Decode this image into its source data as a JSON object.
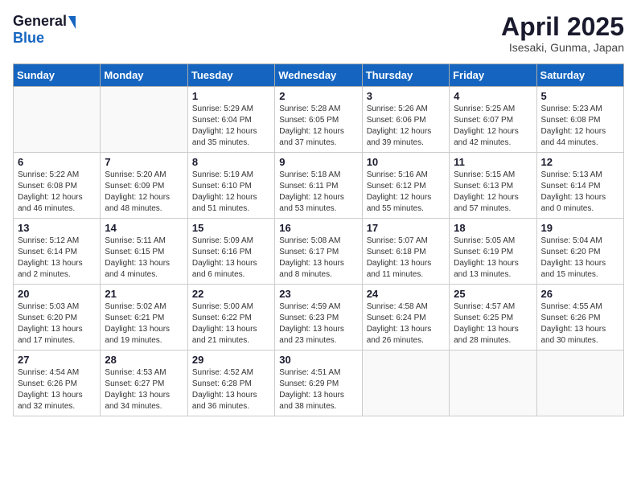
{
  "header": {
    "logo_general": "General",
    "logo_blue": "Blue",
    "month_title": "April 2025",
    "location": "Isesaki, Gunma, Japan"
  },
  "weekdays": [
    "Sunday",
    "Monday",
    "Tuesday",
    "Wednesday",
    "Thursday",
    "Friday",
    "Saturday"
  ],
  "weeks": [
    [
      {
        "day": "",
        "info": ""
      },
      {
        "day": "",
        "info": ""
      },
      {
        "day": "1",
        "info": "Sunrise: 5:29 AM\nSunset: 6:04 PM\nDaylight: 12 hours\nand 35 minutes."
      },
      {
        "day": "2",
        "info": "Sunrise: 5:28 AM\nSunset: 6:05 PM\nDaylight: 12 hours\nand 37 minutes."
      },
      {
        "day": "3",
        "info": "Sunrise: 5:26 AM\nSunset: 6:06 PM\nDaylight: 12 hours\nand 39 minutes."
      },
      {
        "day": "4",
        "info": "Sunrise: 5:25 AM\nSunset: 6:07 PM\nDaylight: 12 hours\nand 42 minutes."
      },
      {
        "day": "5",
        "info": "Sunrise: 5:23 AM\nSunset: 6:08 PM\nDaylight: 12 hours\nand 44 minutes."
      }
    ],
    [
      {
        "day": "6",
        "info": "Sunrise: 5:22 AM\nSunset: 6:08 PM\nDaylight: 12 hours\nand 46 minutes."
      },
      {
        "day": "7",
        "info": "Sunrise: 5:20 AM\nSunset: 6:09 PM\nDaylight: 12 hours\nand 48 minutes."
      },
      {
        "day": "8",
        "info": "Sunrise: 5:19 AM\nSunset: 6:10 PM\nDaylight: 12 hours\nand 51 minutes."
      },
      {
        "day": "9",
        "info": "Sunrise: 5:18 AM\nSunset: 6:11 PM\nDaylight: 12 hours\nand 53 minutes."
      },
      {
        "day": "10",
        "info": "Sunrise: 5:16 AM\nSunset: 6:12 PM\nDaylight: 12 hours\nand 55 minutes."
      },
      {
        "day": "11",
        "info": "Sunrise: 5:15 AM\nSunset: 6:13 PM\nDaylight: 12 hours\nand 57 minutes."
      },
      {
        "day": "12",
        "info": "Sunrise: 5:13 AM\nSunset: 6:14 PM\nDaylight: 13 hours\nand 0 minutes."
      }
    ],
    [
      {
        "day": "13",
        "info": "Sunrise: 5:12 AM\nSunset: 6:14 PM\nDaylight: 13 hours\nand 2 minutes."
      },
      {
        "day": "14",
        "info": "Sunrise: 5:11 AM\nSunset: 6:15 PM\nDaylight: 13 hours\nand 4 minutes."
      },
      {
        "day": "15",
        "info": "Sunrise: 5:09 AM\nSunset: 6:16 PM\nDaylight: 13 hours\nand 6 minutes."
      },
      {
        "day": "16",
        "info": "Sunrise: 5:08 AM\nSunset: 6:17 PM\nDaylight: 13 hours\nand 8 minutes."
      },
      {
        "day": "17",
        "info": "Sunrise: 5:07 AM\nSunset: 6:18 PM\nDaylight: 13 hours\nand 11 minutes."
      },
      {
        "day": "18",
        "info": "Sunrise: 5:05 AM\nSunset: 6:19 PM\nDaylight: 13 hours\nand 13 minutes."
      },
      {
        "day": "19",
        "info": "Sunrise: 5:04 AM\nSunset: 6:20 PM\nDaylight: 13 hours\nand 15 minutes."
      }
    ],
    [
      {
        "day": "20",
        "info": "Sunrise: 5:03 AM\nSunset: 6:20 PM\nDaylight: 13 hours\nand 17 minutes."
      },
      {
        "day": "21",
        "info": "Sunrise: 5:02 AM\nSunset: 6:21 PM\nDaylight: 13 hours\nand 19 minutes."
      },
      {
        "day": "22",
        "info": "Sunrise: 5:00 AM\nSunset: 6:22 PM\nDaylight: 13 hours\nand 21 minutes."
      },
      {
        "day": "23",
        "info": "Sunrise: 4:59 AM\nSunset: 6:23 PM\nDaylight: 13 hours\nand 23 minutes."
      },
      {
        "day": "24",
        "info": "Sunrise: 4:58 AM\nSunset: 6:24 PM\nDaylight: 13 hours\nand 26 minutes."
      },
      {
        "day": "25",
        "info": "Sunrise: 4:57 AM\nSunset: 6:25 PM\nDaylight: 13 hours\nand 28 minutes."
      },
      {
        "day": "26",
        "info": "Sunrise: 4:55 AM\nSunset: 6:26 PM\nDaylight: 13 hours\nand 30 minutes."
      }
    ],
    [
      {
        "day": "27",
        "info": "Sunrise: 4:54 AM\nSunset: 6:26 PM\nDaylight: 13 hours\nand 32 minutes."
      },
      {
        "day": "28",
        "info": "Sunrise: 4:53 AM\nSunset: 6:27 PM\nDaylight: 13 hours\nand 34 minutes."
      },
      {
        "day": "29",
        "info": "Sunrise: 4:52 AM\nSunset: 6:28 PM\nDaylight: 13 hours\nand 36 minutes."
      },
      {
        "day": "30",
        "info": "Sunrise: 4:51 AM\nSunset: 6:29 PM\nDaylight: 13 hours\nand 38 minutes."
      },
      {
        "day": "",
        "info": ""
      },
      {
        "day": "",
        "info": ""
      },
      {
        "day": "",
        "info": ""
      }
    ]
  ]
}
